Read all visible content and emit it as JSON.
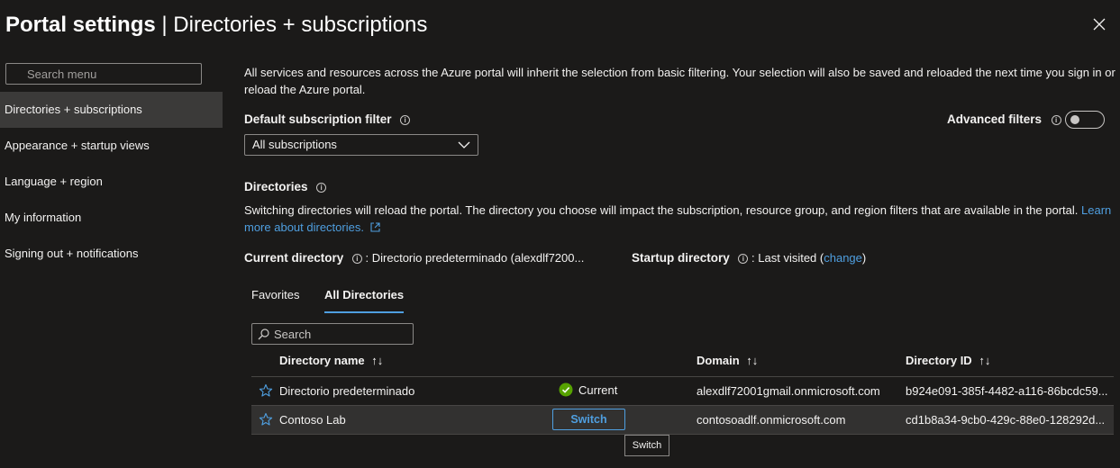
{
  "header": {
    "title_bold": "Portal settings",
    "title_sep": " | ",
    "title_rest": "Directories + subscriptions"
  },
  "sidebar": {
    "search_placeholder": "Search menu",
    "items": [
      {
        "label": "Directories + subscriptions",
        "active": true
      },
      {
        "label": "Appearance + startup views"
      },
      {
        "label": "Language + region"
      },
      {
        "label": "My information"
      },
      {
        "label": "Signing out + notifications"
      }
    ]
  },
  "main": {
    "intro": "All services and resources across the Azure portal will inherit the selection from basic filtering. Your selection will also be saved and reloaded the next time you sign in or reload the Azure portal.",
    "default_filter_label": "Default subscription filter",
    "default_filter_value": "All subscriptions",
    "advanced_filters_label": "Advanced filters",
    "advanced_filters_on": false,
    "directories_label": "Directories",
    "directories_desc": "Switching directories will reload the portal. The directory you choose will impact the subscription, resource group, and region filters that are available in the portal.",
    "learn_more": "Learn more about directories.",
    "current_directory_label": "Current directory",
    "current_directory_value": ": Directorio predeterminado (alexdlf7200...",
    "startup_directory_label": "Startup directory",
    "startup_directory_value": ": Last visited (",
    "startup_change": "change",
    "startup_close": ")",
    "tabs": [
      {
        "label": "Favorites"
      },
      {
        "label": "All Directories",
        "active": true
      }
    ],
    "search_placeholder": "Search",
    "table": {
      "headers": {
        "name": "Directory name",
        "domain": "Domain",
        "id": "Directory ID",
        "sort_glyph": "↑↓"
      },
      "rows": [
        {
          "name": "Directorio predeterminado",
          "status": "Current",
          "domain": "alexdlf72001gmail.onmicrosoft.com",
          "id": "b924e091-385f-4482-a116-86bcdc59..."
        },
        {
          "name": "Contoso Lab",
          "action": "Switch",
          "domain": "contosoadlf.onmicrosoft.com",
          "id": "cd1b8a34-9cb0-429c-88e0-128292d..."
        }
      ]
    },
    "tooltip": "Switch"
  },
  "colors": {
    "background": "#1b1a19",
    "accent": "#4f9fe0",
    "success": "#57a300",
    "selected": "#3b3a39"
  }
}
